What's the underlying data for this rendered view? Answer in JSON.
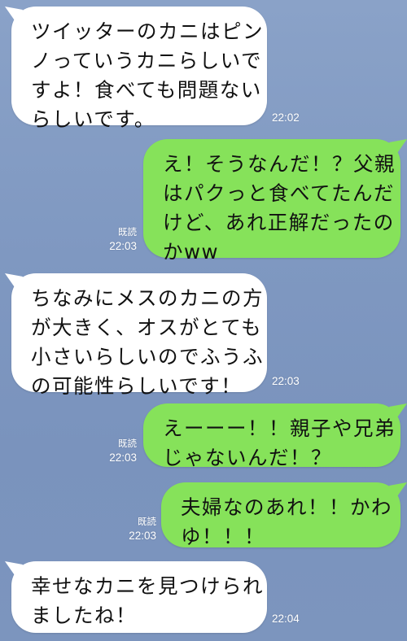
{
  "messages": [
    {
      "side": "in",
      "lines": [
        "ツイッターのカニはピン",
        "ノっていうカニらしいで",
        "すよ！食べても問題ない",
        "らしいです。"
      ],
      "time": "22:02"
    },
    {
      "side": "out",
      "lines": [
        "え！そうなんだ！？父親",
        "はパクっと食べてたんだ",
        "けど、あれ正解だったの",
        "かww"
      ],
      "read": "既読",
      "time": "22:03"
    },
    {
      "side": "in",
      "lines": [
        "ちなみにメスのカニの方",
        "が大きく、オスがとても",
        "小さいらしいのでふうふ",
        "の可能性らしいです！"
      ],
      "time": "22:03"
    },
    {
      "side": "out",
      "lines": [
        "えーーー！！親子や兄弟",
        "じゃないんだ！？"
      ],
      "read": "既読",
      "time": "22:03"
    },
    {
      "side": "out",
      "lines": [
        "夫婦なのあれ！！かわ",
        "ゆ！！！"
      ],
      "read": "既読",
      "time": "22:03"
    },
    {
      "side": "in",
      "lines": [
        "幸せなカニを見つけられ",
        "ましたね！"
      ],
      "time": "22:04"
    }
  ],
  "colors": {
    "incoming_bubble": "#ffffff",
    "outgoing_bubble": "#86e25a",
    "background": "#7f98c1"
  }
}
